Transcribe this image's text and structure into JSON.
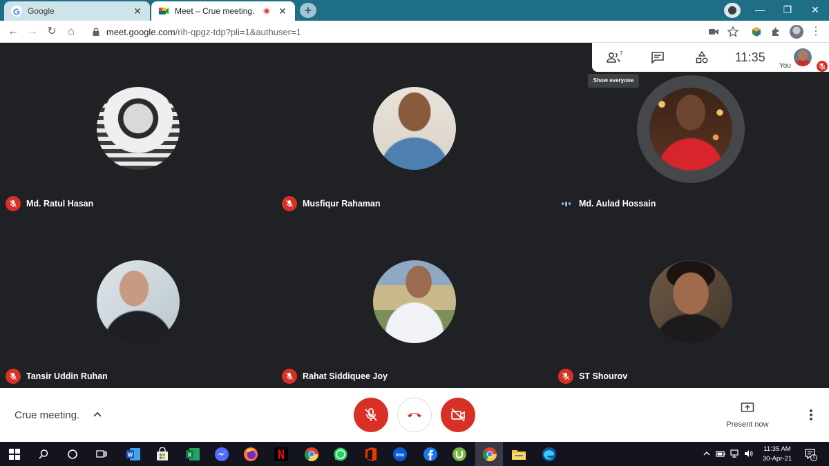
{
  "browser": {
    "tabs": [
      {
        "title": "Google",
        "favicon": "google-g-icon",
        "active": false
      },
      {
        "title": "Meet – Crue meeting.",
        "favicon": "google-meet-icon",
        "active": true,
        "recording": true
      }
    ],
    "new_tab_icon": "plus-icon",
    "url_host": "meet.google.com",
    "url_path": "/rih-qpgz-tdp?pli=1&authuser=1",
    "window_controls": [
      "minimize-icon",
      "restore-icon",
      "close-icon"
    ]
  },
  "meet": {
    "meeting_title": "Crue meeting.",
    "clock": "11:35",
    "people_count": "7",
    "you_label": "You",
    "tooltip": "Show everyone",
    "present_label": "Present now",
    "participants": [
      {
        "name": "Md. Ratul Hasan",
        "muted": true,
        "speaking": false
      },
      {
        "name": "Musfiqur Rahaman",
        "muted": true,
        "speaking": false
      },
      {
        "name": "Md. Aulad Hossain",
        "muted": false,
        "speaking": true
      },
      {
        "name": "Tansir Uddin Ruhan",
        "muted": true,
        "speaking": false
      },
      {
        "name": "Rahat Siddiquee Joy",
        "muted": true,
        "speaking": false
      },
      {
        "name": "ST Shourov",
        "muted": true,
        "speaking": false
      }
    ],
    "controls": [
      "mic-off-icon",
      "hang-up-icon",
      "camera-off-icon"
    ]
  },
  "taskbar": {
    "time": "11:35 AM",
    "date": "30-Apr-21",
    "notification_count": "1",
    "apps": [
      "search-icon",
      "cortana-icon",
      "task-view-icon",
      "word-icon",
      "store-icon",
      "excel-icon",
      "messenger-icon",
      "firefox-icon",
      "netflix-icon",
      "chrome-icon",
      "whatsapp-icon",
      "office-icon",
      "imo-icon",
      "facebook-icon",
      "utorrent-icon",
      "chrome-icon",
      "file-explorer-icon",
      "edge-icon"
    ]
  },
  "colors": {
    "tabstrip": "#1e6f86",
    "stage": "#202124",
    "mute_red": "#d93025",
    "speaking_blue": "#8ab4f8"
  }
}
